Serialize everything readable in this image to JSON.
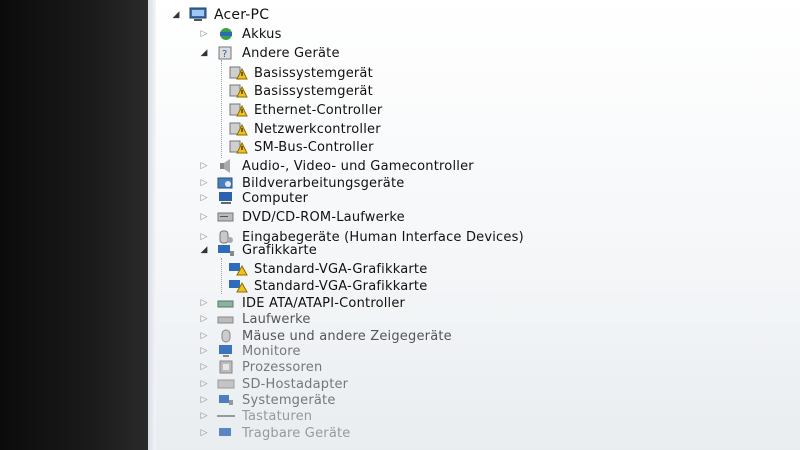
{
  "window": {
    "title": ""
  },
  "tree": {
    "root": {
      "label": "Acer-PC",
      "icon": "computer-icon"
    },
    "items": [
      {
        "label": "Akkus",
        "icon": "battery-icon",
        "expanded": false
      },
      {
        "label": "Andere Geräte",
        "icon": "unknown-device-icon",
        "expanded": true,
        "children": [
          {
            "label": "Basissystemgerät",
            "icon": "warning-device-icon"
          },
          {
            "label": "Basissystemgerät",
            "icon": "warning-device-icon"
          },
          {
            "label": "Ethernet-Controller",
            "icon": "warning-device-icon"
          },
          {
            "label": "Netzwerkcontroller",
            "icon": "warning-device-icon"
          },
          {
            "label": "SM-Bus-Controller",
            "icon": "warning-device-icon"
          }
        ]
      },
      {
        "label": "Audio-, Video- und Gamecontroller",
        "icon": "speaker-icon",
        "expanded": false
      },
      {
        "label": "Bildverarbeitungsgeräte",
        "icon": "camera-icon",
        "expanded": false
      },
      {
        "label": "Computer",
        "icon": "computer-icon",
        "expanded": false
      },
      {
        "label": "DVD/CD-ROM-Laufwerke",
        "icon": "disc-drive-icon",
        "expanded": false
      },
      {
        "label": "Eingabegeräte (Human Interface Devices)",
        "icon": "hid-icon",
        "expanded": false
      },
      {
        "label": "Grafikkarte",
        "icon": "display-adapter-icon",
        "expanded": true,
        "children": [
          {
            "label": "Standard-VGA-Grafikkarte",
            "icon": "warning-display-adapter-icon"
          },
          {
            "label": "Standard-VGA-Grafikkarte",
            "icon": "warning-display-adapter-icon"
          }
        ]
      },
      {
        "label": "IDE ATA/ATAPI-Controller",
        "icon": "ide-controller-icon",
        "expanded": false
      },
      {
        "label": "Laufwerke",
        "icon": "disk-drive-icon",
        "expanded": false
      },
      {
        "label": "Mäuse und andere Zeigegeräte",
        "icon": "mouse-icon",
        "expanded": false
      },
      {
        "label": "Monitore",
        "icon": "monitor-icon",
        "expanded": false
      },
      {
        "label": "Prozessoren",
        "icon": "processor-icon",
        "expanded": false
      },
      {
        "label": "SD-Hostadapter",
        "icon": "sd-adapter-icon",
        "expanded": false
      },
      {
        "label": "Systemgeräte",
        "icon": "system-device-icon",
        "expanded": false
      },
      {
        "label": "Tastaturen",
        "icon": "keyboard-icon",
        "expanded": false
      },
      {
        "label": "Tragbare Geräte",
        "icon": "portable-device-icon",
        "expanded": false
      }
    ]
  },
  "colors": {
    "warning": "#f2c21b",
    "tree_text": "#111111"
  }
}
